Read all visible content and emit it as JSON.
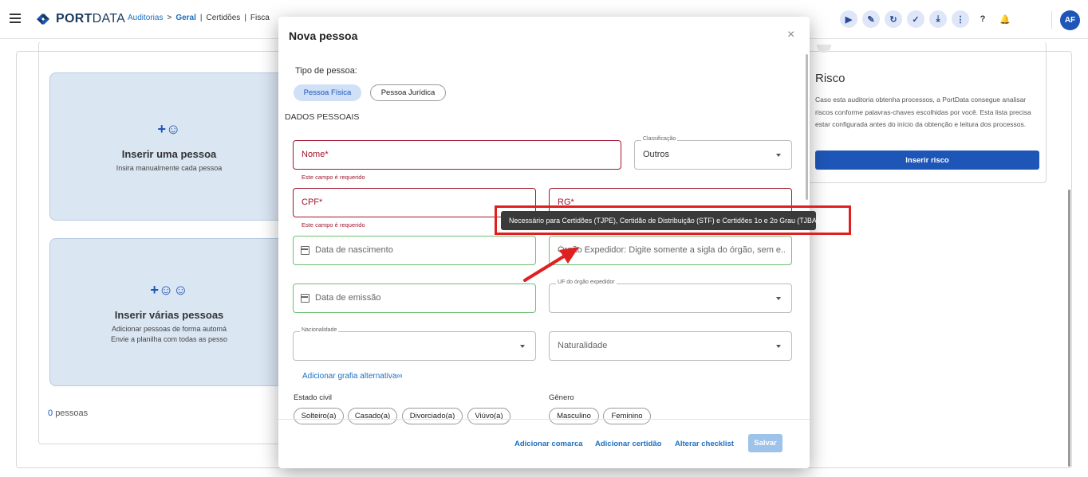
{
  "topbar": {
    "logo_bold": "PORT",
    "logo_light": "DATA",
    "breadcrumb": [
      "Auditorias",
      ">",
      "Geral",
      "|",
      "Certidões",
      "|",
      "Fisca"
    ],
    "avatar": "AF"
  },
  "background": {
    "card1": {
      "title": "Inserir uma pessoa",
      "subtitle": "Insira manualmente cada pessoa"
    },
    "card2": {
      "title": "Inserir várias pessoas",
      "subtitle_line1": "Adicionar pessoas de forma automá",
      "subtitle_line2": "Envie a planilha com todas as pesso"
    },
    "count_num": "0",
    "count_label": "pessoas",
    "risk": {
      "title": "Risco",
      "text": "Caso esta auditoria obtenha processos, a PortData consegue analisar riscos conforme palavras-chaves escolhidas por você. Esta lista precisa estar configurada antes do início da obtenção e leitura dos processos.",
      "button": "Inserir risco"
    }
  },
  "modal": {
    "title": "Nova pessoa",
    "close": "×",
    "tipo_label": "Tipo de pessoa:",
    "tipo_options": [
      "Pessoa Física",
      "Pessoa Jurídica"
    ],
    "section": "DADOS PESSOAIS",
    "fields": {
      "nome": "Nome*",
      "classificacao_legend": "Classificação",
      "classificacao_value": "Outros",
      "cpf": "CPF*",
      "rg": "RG*",
      "nascimento": "Data de nascimento",
      "orgao": "Órgão Expedidor: Digite somente a sigla do órgão, sem e...",
      "emissao": "Data de emissão",
      "uf_legend": "UF do órgão expedidor",
      "nacionalidade_legend": "Nacionalidade",
      "naturalidade": "Naturalidade"
    },
    "required_error": "Este campo é requerido",
    "alt_link": "Adicionar grafia alternativa",
    "estado_civil_label": "Estado civil",
    "estado_civil": [
      "Solteiro(a)",
      "Casado(a)",
      "Divorciado(a)",
      "Viúvo(a)"
    ],
    "genero_label": "Gênero",
    "genero": [
      "Masculino",
      "Feminino"
    ],
    "footer": {
      "comarca": "Adicionar comarca",
      "certidao": "Adicionar certidão",
      "checklist": "Alterar checklist",
      "save": "Salvar"
    }
  },
  "tooltip": "Necessário para Certidões (TJPE), Certidão de Distribuição (STF) e Certidões 1o e 2o Grau (TJBA)",
  "colors": {
    "accent": "#1e56b8",
    "error": "#a1162e",
    "success": "#6fbf73",
    "annotation": "#e02020"
  }
}
